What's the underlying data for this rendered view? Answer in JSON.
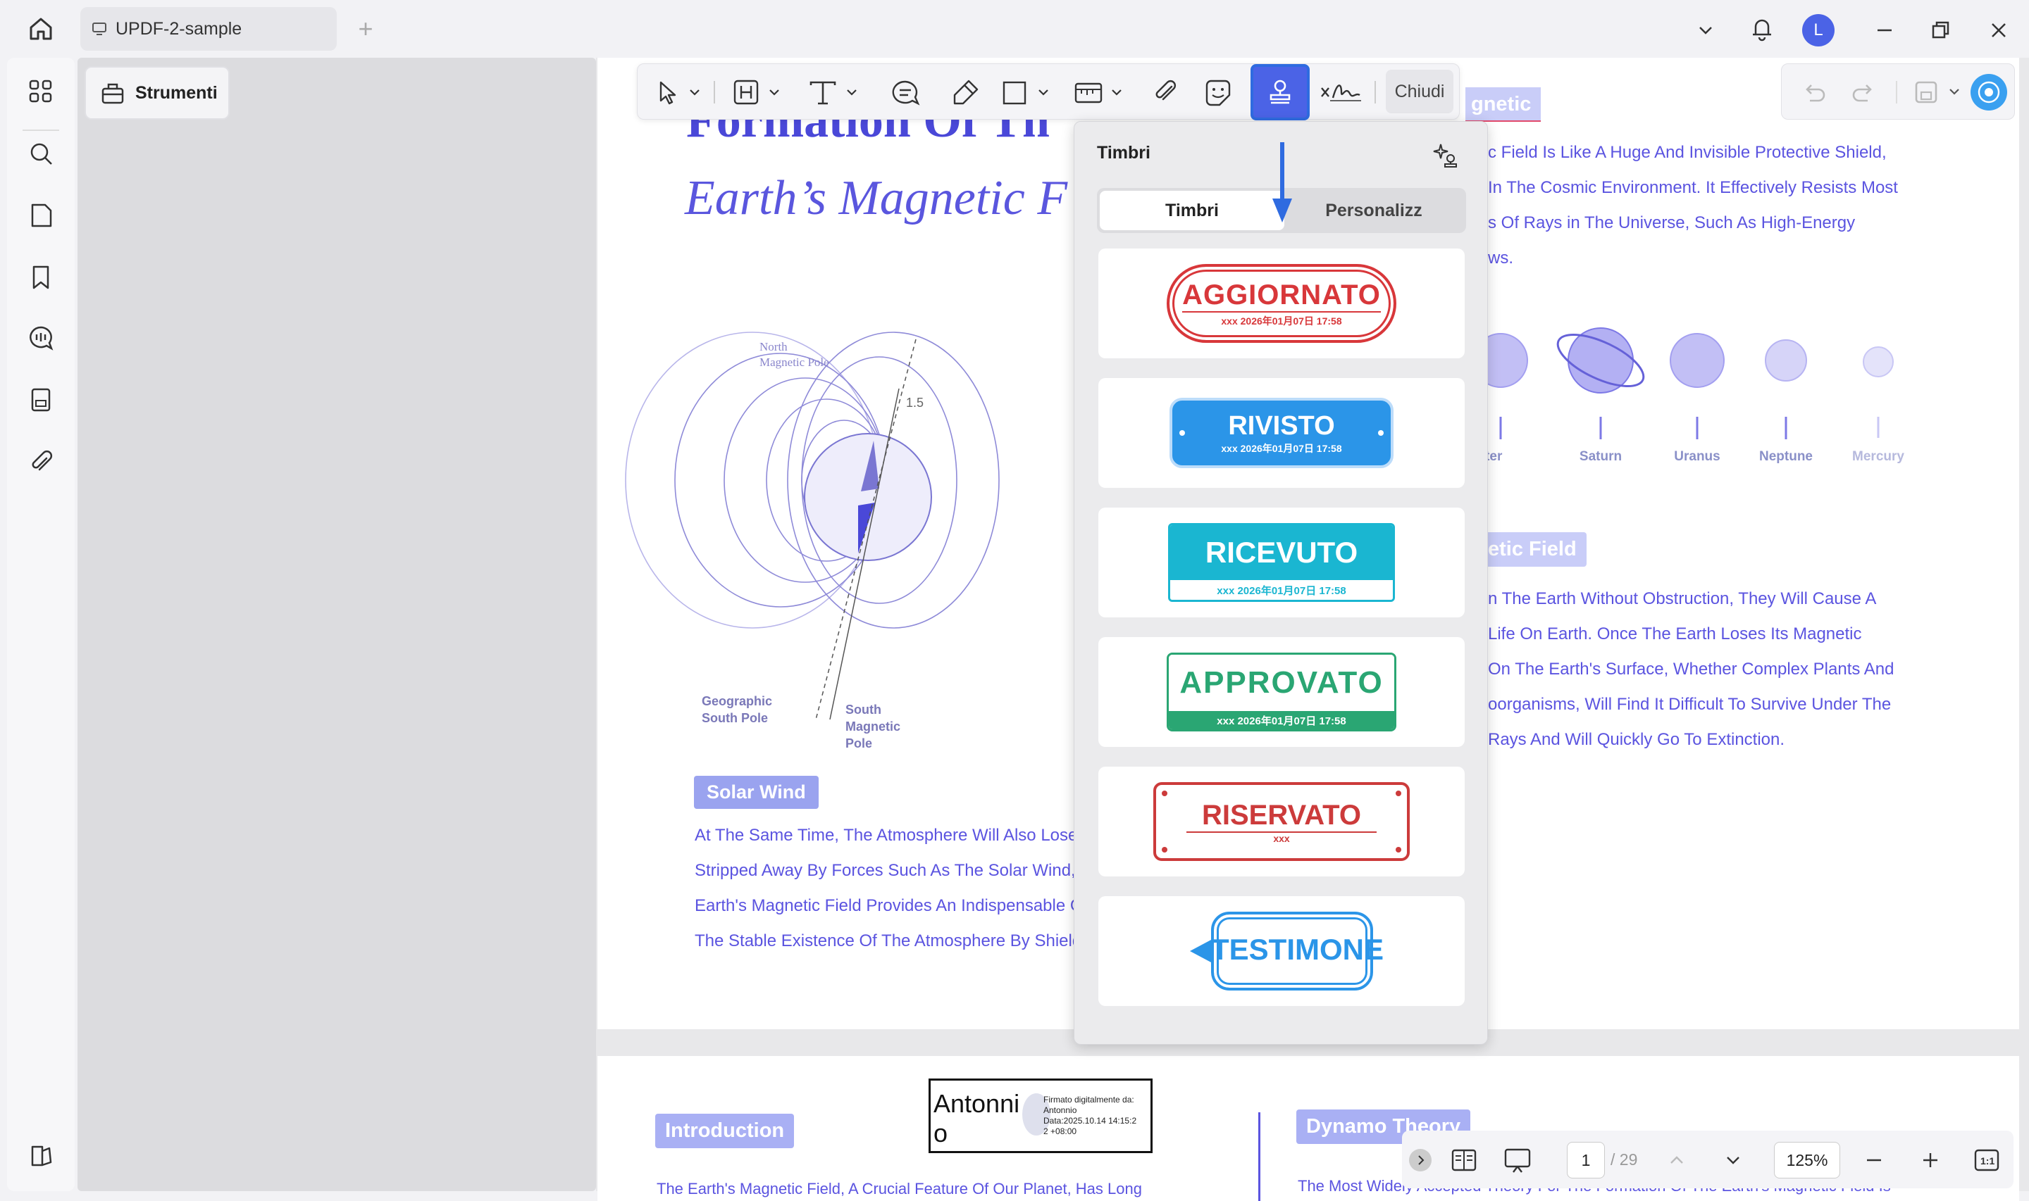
{
  "tab": {
    "title": "UPDF-2-sample"
  },
  "avatar": {
    "initial": "L"
  },
  "sidebar": {
    "strumenti_label": "Strumenti"
  },
  "toolbar": {
    "chiudi_label": "Chiudi"
  },
  "document": {
    "title_partial": "Formation Of Th",
    "subtitle_partial": "Earth’s Magnetic F",
    "diagram_labels": {
      "north_pole": [
        "North",
        "Magnetic Pole"
      ],
      "angle": "1.5",
      "geo_south": [
        "Geographic",
        "South Pole"
      ],
      "south_mag": [
        "South",
        "Magnetic",
        "Pole"
      ]
    },
    "solar_wind": {
      "label": "Solar Wind",
      "lines": [
        "At The Same Time, The Atmosphere Will Also Lose",
        "Stripped Away By Forces Such As The Solar Wind,",
        "Earth's Magnetic Field Provides An Indispensable G",
        "The Stable Existence Of The Atmosphere By Shield"
      ]
    },
    "right_header_partial": "gnetic",
    "right_para": [
      "c Field Is Like A Huge And Invisible Protective Shield,",
      "In The Cosmic Environment. It Effectively Resists Most",
      "s Of Rays in The Universe, Such As High-Energy",
      "ws."
    ],
    "planets": [
      "upiter",
      "Saturn",
      "Uranus",
      "Neptune",
      "Mercury"
    ],
    "right_header2_partial": "etic Field",
    "right_para2": [
      "n The Earth Without Obstruction, They Will Cause A",
      "Life On Earth. Once The Earth Loses Its Magnetic",
      "On The Earth's Surface, Whether Complex Plants And",
      "oorganisms, Will Find It Difficult To Survive Under The",
      "Rays And Will Quickly Go To Extinction."
    ],
    "page2": {
      "introduction": "Introduction",
      "dynamo": "Dynamo Theory",
      "intro_line": "The Earth's Magnetic Field, A Crucial Feature Of Our Planet, Has Long",
      "dynamo_line": "The Most Widely Accepted Theory For The Formation Of The Earth's Magnetic Field Is",
      "signature": {
        "name_line1": "Antonni",
        "name_line2": "o",
        "detail": [
          "Firmato digitalmente da:",
          "Antonnio",
          "Data:2025.10.14 14:15:2",
          "2 +08:00"
        ]
      }
    }
  },
  "stamps_panel": {
    "title": "Timbri",
    "tabs": [
      "Timbri",
      "Personalizz"
    ],
    "stamps": [
      {
        "text": "AGGIORNATO",
        "sub": "xxx 2026年01月07日 17:58",
        "color": "#d8373a"
      },
      {
        "text": "RIVISTO",
        "sub": "xxx 2026年01月07日 17:58",
        "color": "#2b95e8"
      },
      {
        "text": "RICEVUTO",
        "sub": "xxx 2026年01月07日 17:58",
        "color": "#1ab6d1"
      },
      {
        "text": "APPROVATO",
        "sub": "xxx 2026年01月07日 17:58",
        "color": "#2aa673"
      },
      {
        "text": "RISERVATO",
        "sub": "xxx",
        "color": "#cc3b3b"
      },
      {
        "text": "TESTIMONE",
        "sub": "",
        "color": "#2b95e8"
      }
    ]
  },
  "bottom": {
    "page_current": "1",
    "page_total": "/ 29",
    "zoom": "125%"
  }
}
